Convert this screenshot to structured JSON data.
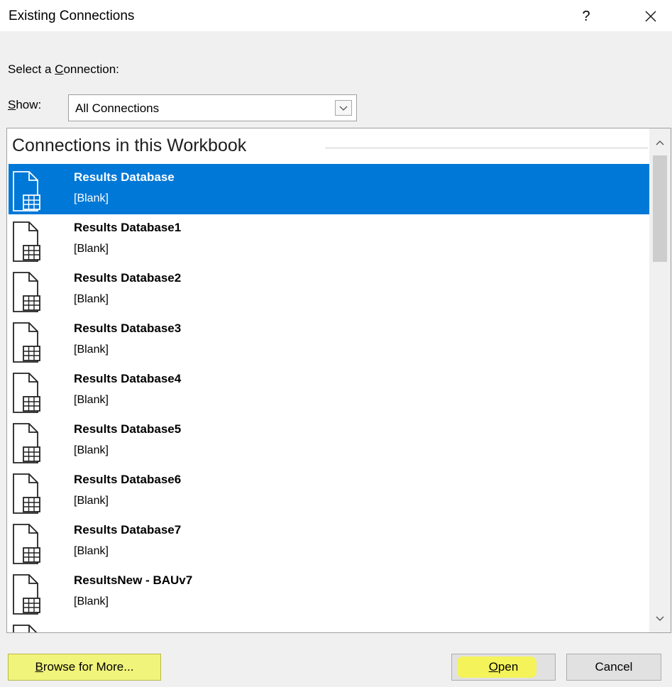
{
  "dialog": {
    "title": "Existing Connections",
    "help_glyph": "?",
    "close_glyph": "×"
  },
  "select_connection": {
    "label_before": "Select a ",
    "label_accel": "C",
    "label_after": "onnection:"
  },
  "show": {
    "label_accel": "S",
    "label_after": "how:",
    "selected": "All Connections"
  },
  "list": {
    "group_header": "Connections in this Workbook",
    "items": [
      {
        "name": "Results Database",
        "desc": "[Blank]",
        "selected": true
      },
      {
        "name": "Results Database1",
        "desc": "[Blank]"
      },
      {
        "name": "Results Database2",
        "desc": "[Blank]"
      },
      {
        "name": "Results Database3",
        "desc": "[Blank]"
      },
      {
        "name": "Results Database4",
        "desc": "[Blank]"
      },
      {
        "name": "Results Database5",
        "desc": "[Blank]"
      },
      {
        "name": "Results Database6",
        "desc": "[Blank]"
      },
      {
        "name": "Results Database7",
        "desc": "[Blank]"
      },
      {
        "name": "ResultsNew - BAUv7",
        "desc": "[Blank]"
      }
    ]
  },
  "buttons": {
    "browse_accel": "B",
    "browse_rest": "rowse for More...",
    "open_accel": "O",
    "open_rest": "pen",
    "cancel": "Cancel"
  },
  "colors": {
    "selection": "#0078d7",
    "highlight": "#f4f35a"
  },
  "icons": {
    "help": "question-icon",
    "close": "close-icon",
    "dropdown": "chevron-down-icon",
    "connection": "table-document-icon",
    "scroll_up": "chevron-up-icon",
    "scroll_down": "chevron-down-icon"
  }
}
